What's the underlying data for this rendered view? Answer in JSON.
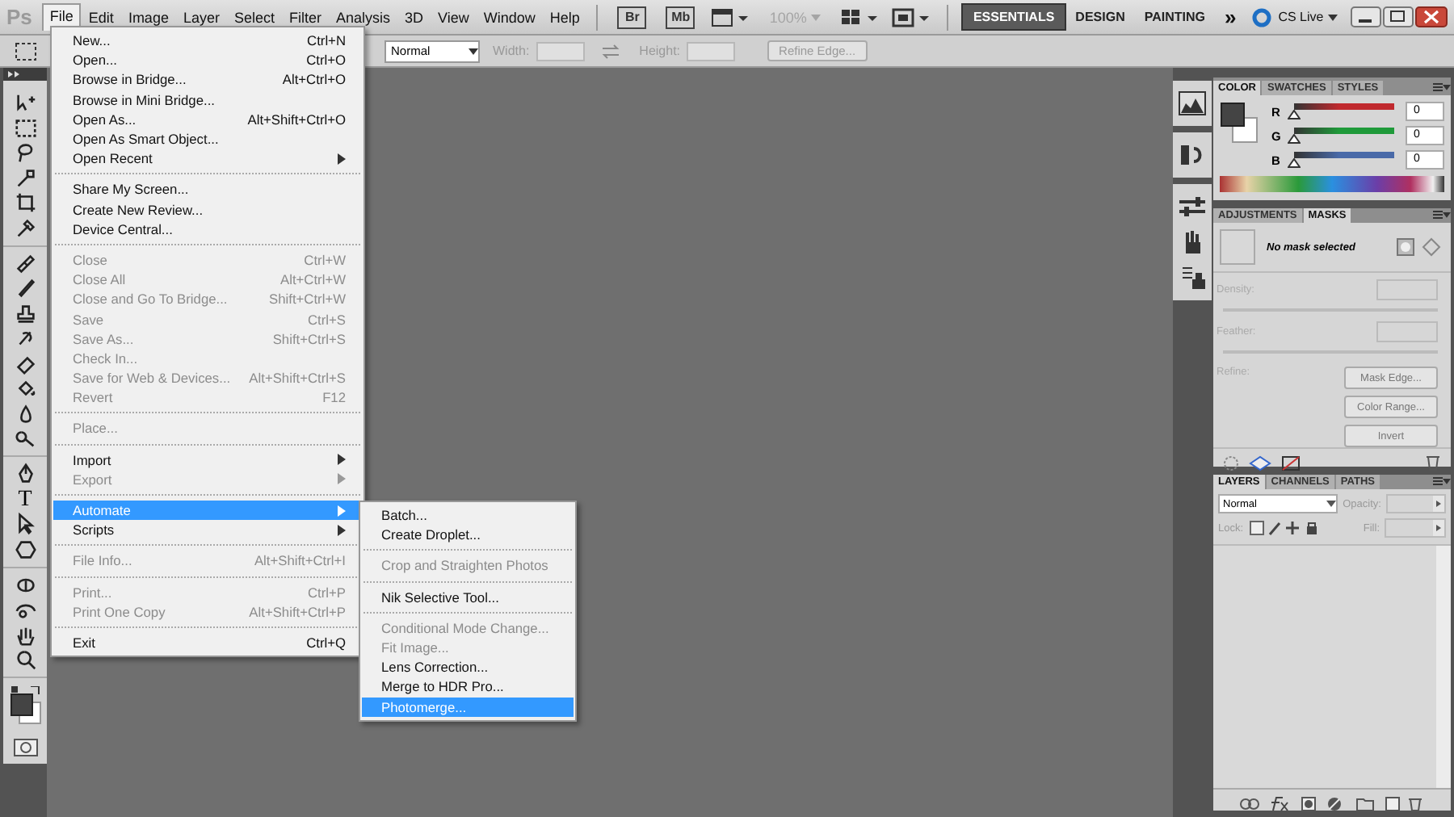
{
  "menubar": {
    "logo": "Ps",
    "menus": [
      {
        "label": "File",
        "selected": true
      },
      {
        "label": "Edit",
        "selected": false
      },
      {
        "label": "Image",
        "selected": false
      },
      {
        "label": "Layer",
        "selected": false
      },
      {
        "label": "Select",
        "selected": false
      },
      {
        "label": "Filter",
        "selected": false
      },
      {
        "label": "Analysis",
        "selected": false
      },
      {
        "label": "3D",
        "selected": false
      },
      {
        "label": "View",
        "selected": false
      },
      {
        "label": "Window",
        "selected": false
      },
      {
        "label": "Help",
        "selected": false
      }
    ],
    "bridge": "Br",
    "mini_bridge": "Mb",
    "zoom": {
      "label": "100%",
      "disabled": true
    },
    "workspaces": [
      {
        "label": "ESSENTIALS",
        "selected": true
      },
      {
        "label": "DESIGN",
        "selected": false
      },
      {
        "label": "PAINTING",
        "selected": false
      }
    ],
    "more": "»",
    "cs_live": "CS Live"
  },
  "options_bar": {
    "style_value": "Normal",
    "width_label": "Width:",
    "height_label": "Height:",
    "refine_button": {
      "label": "Refine Edge...",
      "disabled": true
    }
  },
  "toolbox": {
    "text_tool": "T"
  },
  "file_menu": {
    "sections": [
      [
        {
          "label": "New...",
          "shortcut": "Ctrl+N",
          "disabled": false,
          "submenu": false,
          "selected": false
        },
        {
          "label": "Open...",
          "shortcut": "Ctrl+O",
          "disabled": false,
          "submenu": false,
          "selected": false
        },
        {
          "label": "Browse in Bridge...",
          "shortcut": "Alt+Ctrl+O",
          "disabled": false,
          "submenu": false,
          "selected": false
        },
        {
          "label": "Browse in Mini Bridge...",
          "disabled": false,
          "submenu": false,
          "selected": false
        },
        {
          "label": "Open As...",
          "shortcut": "Alt+Shift+Ctrl+O",
          "disabled": false,
          "submenu": false,
          "selected": false
        },
        {
          "label": "Open As Smart Object...",
          "disabled": false,
          "submenu": false,
          "selected": false
        },
        {
          "label": "Open Recent",
          "disabled": false,
          "submenu": true,
          "selected": false
        }
      ],
      [
        {
          "label": "Share My Screen...",
          "disabled": false,
          "submenu": false,
          "selected": false
        },
        {
          "label": "Create New Review...",
          "disabled": false,
          "submenu": false,
          "selected": false
        },
        {
          "label": "Device Central...",
          "disabled": false,
          "submenu": false,
          "selected": false
        }
      ],
      [
        {
          "label": "Close",
          "shortcut": "Ctrl+W",
          "disabled": true,
          "submenu": false,
          "selected": false
        },
        {
          "label": "Close All",
          "shortcut": "Alt+Ctrl+W",
          "disabled": true,
          "submenu": false,
          "selected": false
        },
        {
          "label": "Close and Go To Bridge...",
          "shortcut": "Shift+Ctrl+W",
          "disabled": true,
          "submenu": false,
          "selected": false
        },
        {
          "label": "Save",
          "shortcut": "Ctrl+S",
          "disabled": true,
          "submenu": false,
          "selected": false
        },
        {
          "label": "Save As...",
          "shortcut": "Shift+Ctrl+S",
          "disabled": true,
          "submenu": false,
          "selected": false
        },
        {
          "label": "Check In...",
          "disabled": true,
          "submenu": false,
          "selected": false
        },
        {
          "label": "Save for Web & Devices...",
          "shortcut": "Alt+Shift+Ctrl+S",
          "disabled": true,
          "submenu": false,
          "selected": false
        },
        {
          "label": "Revert",
          "shortcut": "F12",
          "disabled": true,
          "submenu": false,
          "selected": false
        }
      ],
      [
        {
          "label": "Place...",
          "disabled": true,
          "submenu": false,
          "selected": false
        }
      ],
      [
        {
          "label": "Import",
          "disabled": false,
          "submenu": true,
          "selected": false
        },
        {
          "label": "Export",
          "disabled": true,
          "submenu": true,
          "selected": false
        }
      ],
      [
        {
          "label": "Automate",
          "disabled": false,
          "submenu": true,
          "selected": true
        },
        {
          "label": "Scripts",
          "disabled": false,
          "submenu": true,
          "selected": false
        }
      ],
      [
        {
          "label": "File Info...",
          "shortcut": "Alt+Shift+Ctrl+I",
          "disabled": true,
          "submenu": false,
          "selected": false
        }
      ],
      [
        {
          "label": "Print...",
          "shortcut": "Ctrl+P",
          "disabled": true,
          "submenu": false,
          "selected": false
        },
        {
          "label": "Print One Copy",
          "shortcut": "Alt+Shift+Ctrl+P",
          "disabled": true,
          "submenu": false,
          "selected": false
        }
      ],
      [
        {
          "label": "Exit",
          "shortcut": "Ctrl+Q",
          "disabled": false,
          "submenu": false,
          "selected": false
        }
      ]
    ]
  },
  "automate_menu": {
    "sections": [
      [
        {
          "label": "Batch...",
          "disabled": false,
          "selected": false
        },
        {
          "label": "Create Droplet...",
          "disabled": false,
          "selected": false
        }
      ],
      [
        {
          "label": "Crop and Straighten Photos",
          "disabled": true,
          "selected": false
        }
      ],
      [
        {
          "label": "Nik Selective Tool...",
          "disabled": false,
          "selected": false
        }
      ],
      [
        {
          "label": "Conditional Mode Change...",
          "disabled": true,
          "selected": false
        },
        {
          "label": "Fit Image...",
          "disabled": true,
          "selected": false
        },
        {
          "label": "Lens Correction...",
          "disabled": false,
          "selected": false
        },
        {
          "label": "Merge to HDR Pro...",
          "disabled": false,
          "selected": false
        },
        {
          "label": "Photomerge...",
          "disabled": false,
          "selected": true
        }
      ]
    ]
  },
  "color_panel": {
    "tabs": [
      {
        "label": "COLOR",
        "selected": true
      },
      {
        "label": "SWATCHES",
        "selected": false
      },
      {
        "label": "STYLES",
        "selected": false
      }
    ],
    "channels": [
      {
        "name": "R",
        "value": "0",
        "level": 0,
        "color": "#c0292e"
      },
      {
        "name": "G",
        "value": "0",
        "level": 0,
        "color": "#1f9a3a"
      },
      {
        "name": "B",
        "value": "0",
        "level": 0,
        "color": "#4a6aa8"
      }
    ]
  },
  "masks_panel": {
    "tabs": [
      {
        "label": "ADJUSTMENTS",
        "selected": false
      },
      {
        "label": "MASKS",
        "selected": true
      }
    ],
    "status": "No mask selected",
    "density_label": "Density:",
    "feather_label": "Feather:",
    "refine_label": "Refine:",
    "buttons": [
      "Mask Edge...",
      "Color Range...",
      "Invert"
    ]
  },
  "layers_panel": {
    "tabs": [
      {
        "label": "LAYERS",
        "selected": true
      },
      {
        "label": "CHANNELS",
        "selected": false
      },
      {
        "label": "PATHS",
        "selected": false
      }
    ],
    "blend_mode": "Normal",
    "opacity_label": "Opacity:",
    "lock_label": "Lock:",
    "fill_label": "Fill:"
  }
}
